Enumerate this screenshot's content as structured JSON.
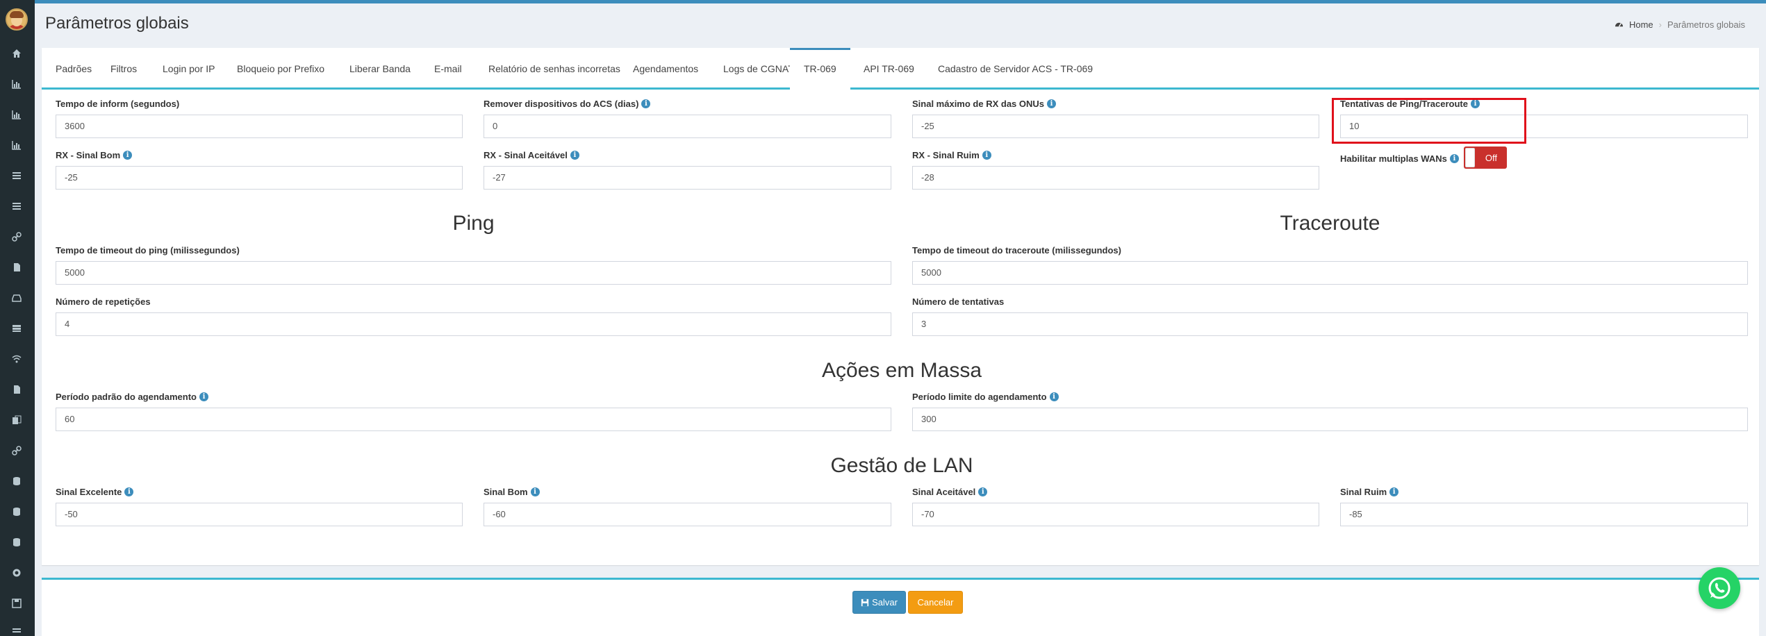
{
  "header": {
    "title": "Parâmetros globais",
    "breadcrumb": {
      "home": "Home",
      "current": "Parâmetros globais"
    }
  },
  "tabs": [
    "Padrões",
    "Filtros",
    "Login por IP",
    "Bloqueio por Prefixo",
    "Liberar Banda",
    "E-mail",
    "Relatório de senhas incorretas",
    "Agendamentos",
    "Logs de CGNAT",
    "TR-069",
    "API TR-069",
    "Cadastro de Servidor ACS - TR-069"
  ],
  "active_tab": "TR-069",
  "fields": {
    "inform": {
      "label": "Tempo de inform (segundos)",
      "value": "3600"
    },
    "remove_acs": {
      "label": "Remover dispositivos do ACS (dias)",
      "value": "0"
    },
    "max_rx": {
      "label": "Sinal máximo de RX das ONUs",
      "value": "-25"
    },
    "ping_tries": {
      "label": "Tentativas de Ping/Traceroute",
      "value": "10"
    },
    "rx_good": {
      "label": "RX - Sinal Bom",
      "value": "-25"
    },
    "rx_acceptable": {
      "label": "RX - Sinal Aceitável",
      "value": "-27"
    },
    "rx_bad": {
      "label": "RX - Sinal Ruim",
      "value": "-28"
    },
    "multi_wan": {
      "label": "Habilitar multiplas WANs",
      "state": "Off"
    },
    "ping_timeout": {
      "label": "Tempo de timeout do ping (milissegundos)",
      "value": "5000"
    },
    "ping_reps": {
      "label": "Número de repetições",
      "value": "4"
    },
    "trace_timeout": {
      "label": "Tempo de timeout do traceroute (milissegundos)",
      "value": "5000"
    },
    "trace_tries": {
      "label": "Número de tentativas",
      "value": "3"
    },
    "sched_default": {
      "label": "Período padrão do agendamento",
      "value": "60"
    },
    "sched_limit": {
      "label": "Período limite do agendamento",
      "value": "300"
    },
    "lan_excellent": {
      "label": "Sinal Excelente",
      "value": "-50"
    },
    "lan_good": {
      "label": "Sinal Bom",
      "value": "-60"
    },
    "lan_acceptable": {
      "label": "Sinal Aceitável",
      "value": "-70"
    },
    "lan_bad": {
      "label": "Sinal Ruim",
      "value": "-85"
    }
  },
  "sections": {
    "ping": "Ping",
    "traceroute": "Traceroute",
    "mass": "Ações em Massa",
    "lan": "Gestão de LAN"
  },
  "buttons": {
    "save": "Salvar",
    "cancel": "Cancelar"
  },
  "icons": {
    "sidebar": [
      "home-icon",
      "chart-icon",
      "chart-icon",
      "chart-icon",
      "list-icon",
      "list-icon",
      "link-icon",
      "file-icon",
      "inbox-icon",
      "server-icon",
      "wifi-icon",
      "file-icon",
      "copy-icon",
      "link-icon",
      "database-icon",
      "database-icon",
      "database-icon",
      "gear-icon",
      "save-icon",
      "menu-icon"
    ]
  },
  "colors": {
    "primary": "#3c8dbc",
    "accent": "#3cb8d0",
    "danger": "#c9302c",
    "warning": "#f39c12",
    "sidebar": "#222d32",
    "highlight": "#e0101b"
  }
}
